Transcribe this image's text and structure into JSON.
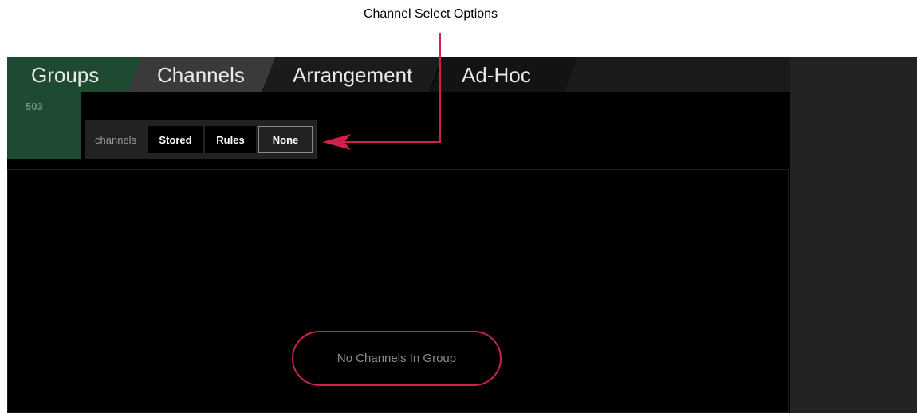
{
  "annotation": {
    "label": "Channel Select Options",
    "color": "#d1214b"
  },
  "tabs": [
    {
      "label": "Groups",
      "active": true
    },
    {
      "label": "Channels"
    },
    {
      "label": "Arrangement"
    },
    {
      "label": "Ad-Hoc"
    }
  ],
  "group": {
    "id": "503"
  },
  "channel_select": {
    "label": "channels",
    "options": [
      {
        "label": "Stored"
      },
      {
        "label": "Rules"
      },
      {
        "label": "None",
        "selected": true
      }
    ]
  },
  "content": {
    "empty_message": "No Channels In Group"
  },
  "colors": {
    "accent_green": "#1d4a31",
    "accent_red": "#d1214b"
  }
}
